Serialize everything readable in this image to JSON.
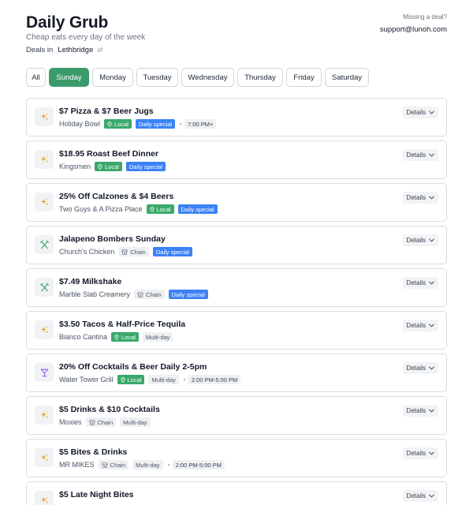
{
  "header": {
    "title": "Daily Grub",
    "subtitle": "Cheap eats every day of the week",
    "deals_in_label": "Deals in",
    "city": "Lethbridge",
    "missing_deal": "Missing a deal?",
    "email": "support@lunoh.com"
  },
  "days": [
    {
      "label": "All",
      "active": false
    },
    {
      "label": "Sunday",
      "active": true
    },
    {
      "label": "Monday",
      "active": false
    },
    {
      "label": "Tuesday",
      "active": false
    },
    {
      "label": "Wednesday",
      "active": false
    },
    {
      "label": "Thursday",
      "active": false
    },
    {
      "label": "Friday",
      "active": false
    },
    {
      "label": "Saturday",
      "active": false
    }
  ],
  "details_label": "Details",
  "deals": [
    {
      "title": "$7 Pizza & $7 Beer Jugs",
      "venue": "Holiday Bowl",
      "icon": "sparkle-icon",
      "type": "Local",
      "tag": "Daily special",
      "time": "7:00 PM+"
    },
    {
      "title": "$18.95 Roast Beef Dinner",
      "venue": "Kingsmen",
      "icon": "sparkle-icon",
      "type": "Local",
      "tag": "Daily special",
      "time": ""
    },
    {
      "title": "25% Off Calzones & $4 Beers",
      "venue": "Two Guys & A Pizza Place",
      "icon": "sparkle-icon",
      "type": "Local",
      "tag": "Daily special",
      "time": ""
    },
    {
      "title": "Jalapeno Bombers Sunday",
      "venue": "Church's Chicken",
      "icon": "utensils-icon",
      "type": "Chain",
      "tag": "Daily special",
      "time": ""
    },
    {
      "title": "$7.49 Milkshake",
      "venue": "Marble Slab Creamery",
      "icon": "utensils-icon",
      "type": "Chain",
      "tag": "Daily special",
      "time": ""
    },
    {
      "title": "$3.50 Tacos & Half-Price Tequila",
      "venue": "Bianco Cantina",
      "icon": "sparkle-icon",
      "type": "Local",
      "tag": "Multi-day",
      "time": ""
    },
    {
      "title": "20% Off Cocktails & Beer Daily 2-5pm",
      "venue": "Water Tower Grill",
      "icon": "cocktail-icon",
      "type": "Local",
      "tag": "Multi-day",
      "time": "2:00 PM-5:00 PM"
    },
    {
      "title": "$5 Drinks & $10 Cocktails",
      "venue": "Moxies",
      "icon": "sparkle-icon",
      "type": "Chain",
      "tag": "Multi-day",
      "time": ""
    },
    {
      "title": "$5 Bites & Drinks",
      "venue": "MR MIKES",
      "icon": "sparkle-icon",
      "type": "Chain",
      "tag": "Multi-day",
      "time": "2:00 PM-5:00 PM"
    },
    {
      "title": "$5 Late Night Bites",
      "venue": "",
      "icon": "sparkle-icon",
      "type": "",
      "tag": "",
      "time": ""
    }
  ],
  "colors": {
    "accent_green": "#3a9b6a",
    "local_badge": "#3aa96b",
    "special_badge": "#3b82f6",
    "sparkle": "#f5a623",
    "utensils": "#3aa96b",
    "cocktail": "#8b5cf6"
  }
}
